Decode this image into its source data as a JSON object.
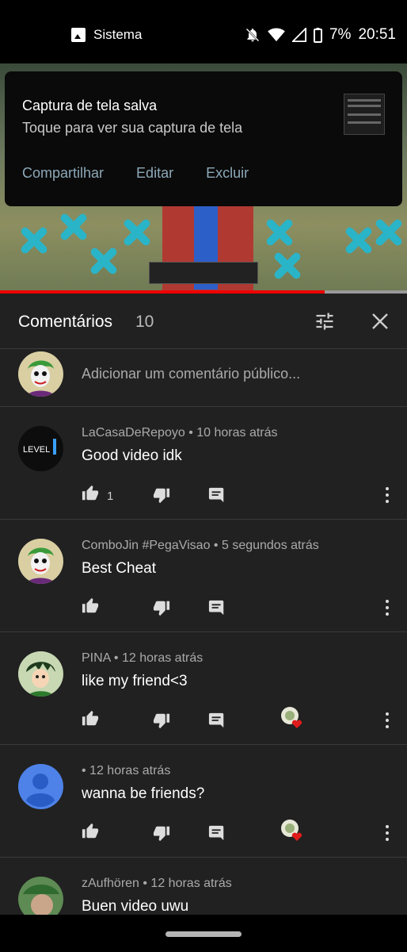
{
  "status_bar": {
    "app_label": "Sistema",
    "battery": "7%",
    "time": "20:51",
    "icons": [
      "image-icon",
      "bell-off-icon",
      "wifi-icon",
      "signal-icon",
      "battery-icon"
    ]
  },
  "notification": {
    "title": "Captura de tela salva",
    "subtitle": "Toque para ver sua captura de tela",
    "actions": [
      "Compartilhar",
      "Editar",
      "Excluir"
    ]
  },
  "comments_panel": {
    "title": "Comentários",
    "count": "10",
    "add_placeholder": "Adicionar um comentário público...",
    "comments": [
      {
        "author": "LaCasaDeRepoyo",
        "time": "10 horas atrás",
        "meta": "LaCasaDeRepoyo • 10 horas atrás",
        "text": "Good video idk",
        "likes": "1",
        "avatar": "level1",
        "creator_heart": false
      },
      {
        "author": "ComboJin #PegaVisao",
        "time": "5 segundos atrás",
        "meta": "ComboJin #PegaVisao • 5 segundos atrás",
        "text": "Best Cheat",
        "likes": "",
        "avatar": "joker",
        "creator_heart": false
      },
      {
        "author": "PINA",
        "time": "12 horas atrás",
        "meta": "PINA • 12 horas atrás",
        "text": "like my friend<3",
        "likes": "",
        "avatar": "pina",
        "creator_heart": true
      },
      {
        "author": "",
        "time": "12 horas atrás",
        "meta": " • 12 horas atrás",
        "text": "wanna be friends?",
        "likes": "",
        "avatar": "default",
        "creator_heart": true
      },
      {
        "author": "zAufhören",
        "time": "12 horas atrás",
        "meta": "zAufhören • 12 horas atrás",
        "text": "Buen video uwu",
        "likes": "",
        "avatar": "zauf",
        "creator_heart": false
      }
    ]
  },
  "colors": {
    "panel_bg": "#212121",
    "accent_action": "#8da8b8",
    "progress_red": "#ee0000",
    "heart_red": "#e01b1b"
  }
}
